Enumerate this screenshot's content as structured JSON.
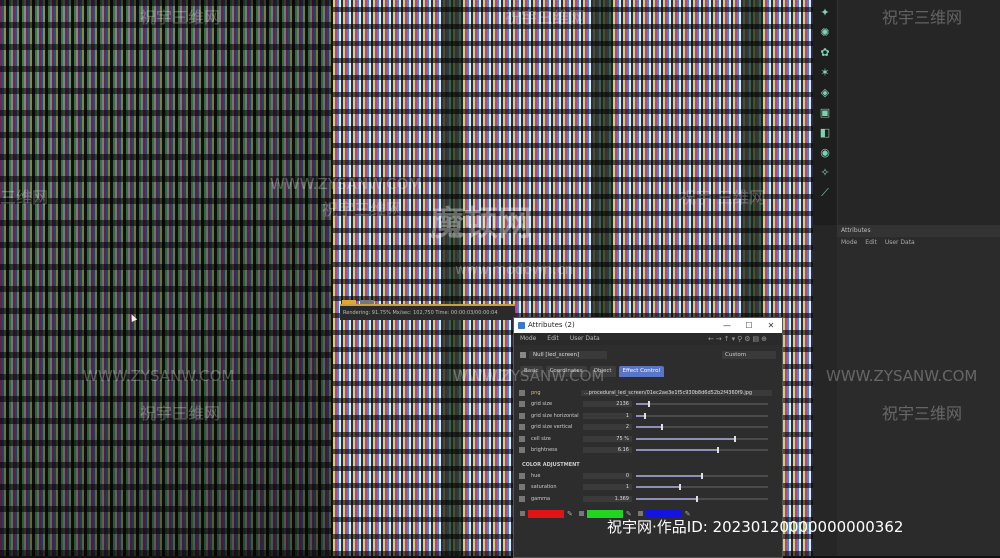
{
  "render_status": "Rendering: 91.75%   Mx/sec: 102,750   Time: 00:00:03/00:00:04",
  "attributes_panel": {
    "tab": "Attributes",
    "menu": [
      "Mode",
      "Edit",
      "User Data"
    ]
  },
  "window": {
    "title": "Attributes (2)",
    "controls": [
      "—",
      "☐",
      "✕"
    ],
    "menu": [
      "Mode",
      "Edit",
      "User Data"
    ],
    "object_name": "Null [led_screen]",
    "mode_dropdown": "Custom",
    "tabs": [
      {
        "label": "Basic",
        "active": false
      },
      {
        "label": "Coordinates",
        "active": false
      },
      {
        "label": "Object",
        "active": false
      },
      {
        "label": "Effect Control",
        "active": true
      }
    ],
    "png": {
      "label": "png",
      "value": "...procedural_led_screen/01ec2ae3e1f5c930b8d6d52b2f4360f9.jpg"
    },
    "params": [
      {
        "label": "grid size",
        "value": "2136",
        "fill": 0.1
      },
      {
        "label": "grid size horizontal",
        "value": "1",
        "fill": 0.07
      },
      {
        "label": "grid size vertical",
        "value": "2",
        "fill": 0.2
      },
      {
        "label": "cell size",
        "value": "75 %",
        "fill": 0.75
      },
      {
        "label": "brightness",
        "value": "6.16",
        "fill": 0.62
      }
    ],
    "color_heading": "COLOR ADJUSTMENT",
    "color_params": [
      {
        "label": "hue",
        "value": "0",
        "fill": 0.5
      },
      {
        "label": "saturation",
        "value": "1",
        "fill": 0.33
      },
      {
        "label": "gamma",
        "value": "1.369",
        "fill": 0.46
      }
    ],
    "swatches": [
      {
        "label": "R",
        "color": "#e01414"
      },
      {
        "label": "G",
        "color": "#22d422"
      },
      {
        "label": "B",
        "color": "#1414e0"
      }
    ]
  },
  "watermarks": {
    "site": "WWW.ZYSANW.COM",
    "site_cn": "祝宇三维网",
    "san_wei_wang": "三维网",
    "zhu_yu_san_wei_wang_spaced": "祝宇 三维网",
    "center_cn": "魔顿网",
    "center_url": "www.modown.cn"
  },
  "footer": "祝宇网·作品ID: 20230120000000000362"
}
